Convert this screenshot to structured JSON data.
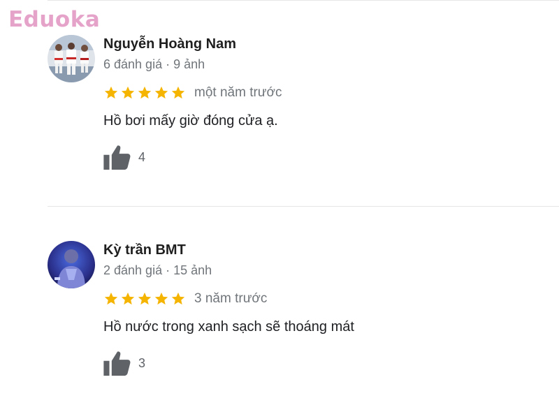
{
  "watermark": {
    "text": "Eduoka"
  },
  "colors": {
    "star": "#f5b400",
    "watermark": "#e39ac4",
    "secondary_text": "#70757a",
    "thumb": "#5f6368"
  },
  "reviews": [
    {
      "name": "Nguyễn Hoàng Nam",
      "meta": "6 đánh giá · 9 ảnh",
      "rating": 5,
      "time": "một năm trước",
      "text": "Hồ bơi mấy giờ đóng cửa ạ.",
      "likes": "4",
      "avatar_icon": "karate-kids-photo"
    },
    {
      "name": "Kỳ trần BMT",
      "meta": "2 đánh giá · 15 ảnh",
      "rating": 5,
      "time": "3 năm trước",
      "text": "Hồ nước trong xanh sạch sẽ thoáng mát",
      "likes": "3",
      "avatar_icon": "person-photo"
    }
  ]
}
